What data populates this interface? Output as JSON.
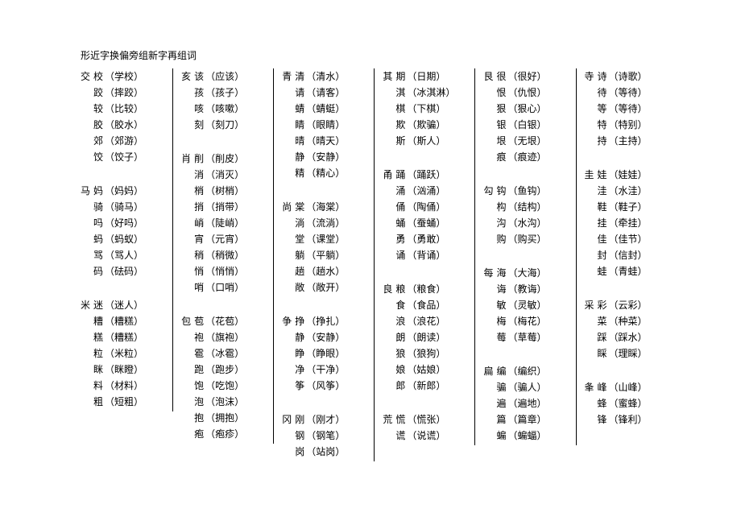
{
  "title": "形近字换偏旁组新字再组词",
  "columns": [
    {
      "groups": [
        {
          "radical": "交",
          "items": [
            {
              "char": "校",
              "word": "（学校）"
            },
            {
              "char": "跤",
              "word": "（摔跤）"
            },
            {
              "char": "较",
              "word": "（比较）"
            },
            {
              "char": "胶",
              "word": "（胶水）"
            },
            {
              "char": "郊",
              "word": "（郊游）"
            },
            {
              "char": "饺",
              "word": "（饺子）"
            }
          ]
        },
        {
          "radical": "马",
          "items": [
            {
              "char": "妈",
              "word": "（妈妈）"
            },
            {
              "char": "骑",
              "word": "（骑马）"
            },
            {
              "char": "吗",
              "word": "（好吗）"
            },
            {
              "char": "蚂",
              "word": "（蚂蚁）"
            },
            {
              "char": "骂",
              "word": "（骂人）"
            },
            {
              "char": "码",
              "word": "（砝码）"
            }
          ]
        },
        {
          "radical": "米",
          "items": [
            {
              "char": "迷",
              "word": "（迷人）"
            },
            {
              "char": "糟",
              "word": "（糟糕）"
            },
            {
              "char": "糕",
              "word": "（糟糕）"
            },
            {
              "char": "粒",
              "word": "（米粒）"
            },
            {
              "char": "眯",
              "word": "（眯瞪）"
            },
            {
              "char": "料",
              "word": "（材料）"
            },
            {
              "char": "粗",
              "word": "（短粗）"
            }
          ]
        }
      ]
    },
    {
      "groups": [
        {
          "radical": "亥",
          "items": [
            {
              "char": "该",
              "word": "（应该）"
            },
            {
              "char": "孩",
              "word": "（孩子）"
            },
            {
              "char": "咳",
              "word": "（咳嗽）"
            },
            {
              "char": "刻",
              "word": "（刻刀）"
            }
          ]
        },
        {
          "radical": "肖",
          "items": [
            {
              "char": "削",
              "word": "（削皮）"
            },
            {
              "char": "消",
              "word": "（消灭）"
            },
            {
              "char": "梢",
              "word": "（树梢）"
            },
            {
              "char": "捎",
              "word": "（捎带）"
            },
            {
              "char": "峭",
              "word": "（陡峭）"
            },
            {
              "char": "宵",
              "word": "（元宵）"
            },
            {
              "char": "稍",
              "word": "（稍微）"
            },
            {
              "char": "悄",
              "word": "（悄悄）"
            },
            {
              "char": "哨",
              "word": "（口哨）"
            }
          ]
        },
        {
          "radical": "包",
          "items": [
            {
              "char": "苞",
              "word": "（花苞）"
            },
            {
              "char": "袍",
              "word": "（旗袍）"
            },
            {
              "char": "雹",
              "word": "（冰雹）"
            },
            {
              "char": "跑",
              "word": "（跑步）"
            },
            {
              "char": "饱",
              "word": "（吃饱）"
            },
            {
              "char": "泡",
              "word": "（泡沫）"
            },
            {
              "char": "抱",
              "word": "（拥抱）"
            },
            {
              "char": "疱",
              "word": "（疱疹）"
            }
          ]
        }
      ]
    },
    {
      "groups": [
        {
          "radical": "青",
          "items": [
            {
              "char": "清",
              "word": "（清水）"
            },
            {
              "char": "请",
              "word": "（请客）"
            },
            {
              "char": "蜻",
              "word": "（蜻蜓）"
            },
            {
              "char": "睛",
              "word": "（眼睛）"
            },
            {
              "char": "晴",
              "word": "（晴天）"
            },
            {
              "char": "静",
              "word": "（安静）"
            },
            {
              "char": "精",
              "word": "（精心）"
            }
          ]
        },
        {
          "radical": "尚",
          "items": [
            {
              "char": "棠",
              "word": "（海棠）"
            },
            {
              "char": "淌",
              "word": "（流淌）"
            },
            {
              "char": "堂",
              "word": "（课堂）"
            },
            {
              "char": "躺",
              "word": "（平躺）"
            },
            {
              "char": "趟",
              "word": "（趟水）"
            },
            {
              "char": "敞",
              "word": "（敞开）"
            }
          ]
        },
        {
          "radical": "争",
          "items": [
            {
              "char": "挣",
              "word": "（挣扎）"
            },
            {
              "char": "静",
              "word": "（安静）"
            },
            {
              "char": "睁",
              "word": "（睁眼）"
            },
            {
              "char": "净",
              "word": "（干净）"
            },
            {
              "char": "筝",
              "word": "（风筝）"
            }
          ]
        },
        {
          "radical": "冈",
          "items": [
            {
              "char": "刚",
              "word": "（刚才）"
            },
            {
              "char": "钢",
              "word": "（钢笔）"
            },
            {
              "char": "岗",
              "word": "（站岗）"
            }
          ]
        }
      ]
    },
    {
      "groups": [
        {
          "radical": "其",
          "items": [
            {
              "char": "期",
              "word": "（日期）"
            },
            {
              "char": "淇",
              "word": "（冰淇淋）"
            },
            {
              "char": "棋",
              "word": "（下棋）"
            },
            {
              "char": "欺",
              "word": "（欺骗）"
            },
            {
              "char": "斯",
              "word": "（斯人）"
            }
          ]
        },
        {
          "radical": "甬",
          "items": [
            {
              "char": "踊",
              "word": "（踊跃）"
            },
            {
              "char": "涌",
              "word": "（汹涌）"
            },
            {
              "char": "俑",
              "word": "（陶俑）"
            },
            {
              "char": "蛹",
              "word": "（蚕蛹）"
            },
            {
              "char": "勇",
              "word": "（勇敢）"
            },
            {
              "char": "诵",
              "word": "（背诵）"
            }
          ]
        },
        {
          "radical": "良",
          "items": [
            {
              "char": "粮",
              "word": "（粮食）"
            },
            {
              "char": "食",
              "word": "（食品）"
            },
            {
              "char": "浪",
              "word": "（浪花）"
            },
            {
              "char": "朗",
              "word": "（朗读）"
            },
            {
              "char": "狼",
              "word": "（狼狗）"
            },
            {
              "char": "娘",
              "word": "（姑娘）"
            },
            {
              "char": "郎",
              "word": "（新郎）"
            }
          ]
        },
        {
          "radical": "荒",
          "items": [
            {
              "char": "慌",
              "word": "（慌张）"
            },
            {
              "char": "谎",
              "word": "（说谎）"
            }
          ]
        }
      ]
    },
    {
      "groups": [
        {
          "radical": "艮",
          "items": [
            {
              "char": "很",
              "word": "（很好）"
            },
            {
              "char": "恨",
              "word": "（仇恨）"
            },
            {
              "char": "狠",
              "word": "（狠心）"
            },
            {
              "char": "银",
              "word": "（白银）"
            },
            {
              "char": "垠",
              "word": "（无垠）"
            },
            {
              "char": "痕",
              "word": "（痕迹）"
            }
          ]
        },
        {
          "radical": "勾",
          "items": [
            {
              "char": "钩",
              "word": "（鱼钩）"
            },
            {
              "char": "构",
              "word": "（结构）"
            },
            {
              "char": "沟",
              "word": "（水沟）"
            },
            {
              "char": "购",
              "word": "（购买）"
            }
          ]
        },
        {
          "radical": "每",
          "items": [
            {
              "char": "海",
              "word": "（大海）"
            },
            {
              "char": "诲",
              "word": "（教诲）"
            },
            {
              "char": "敏",
              "word": "（灵敏）"
            },
            {
              "char": "梅",
              "word": "（梅花）"
            },
            {
              "char": "莓",
              "word": "（草莓）"
            }
          ]
        },
        {
          "radical": "扁",
          "items": [
            {
              "char": "编",
              "word": "（编织）"
            },
            {
              "char": "骗",
              "word": "（骗人）"
            },
            {
              "char": "遍",
              "word": "（遍地）"
            },
            {
              "char": "篇",
              "word": "（篇章）"
            },
            {
              "char": "蝙",
              "word": "（蝙蝠）"
            }
          ]
        }
      ]
    },
    {
      "groups": [
        {
          "radical": "寺",
          "items": [
            {
              "char": "诗",
              "word": "（诗歌）"
            },
            {
              "char": "待",
              "word": "（等待）"
            },
            {
              "char": "等",
              "word": "（等待）"
            },
            {
              "char": "特",
              "word": "（特别）"
            },
            {
              "char": "持",
              "word": "（主持）"
            }
          ]
        },
        {
          "radical": "圭",
          "items": [
            {
              "char": "娃",
              "word": "（娃娃）"
            },
            {
              "char": "洼",
              "word": "（水洼）"
            },
            {
              "char": "鞋",
              "word": "（鞋子）"
            },
            {
              "char": "挂",
              "word": "（牵挂）"
            },
            {
              "char": "佳",
              "word": "（佳节）"
            },
            {
              "char": "封",
              "word": "（信封）"
            },
            {
              "char": "蛙",
              "word": "（青蛙）"
            }
          ]
        },
        {
          "radical": "采",
          "items": [
            {
              "char": "彩",
              "word": "（云彩）"
            },
            {
              "char": "菜",
              "word": "（种菜）"
            },
            {
              "char": "踩",
              "word": "（踩水）"
            },
            {
              "char": "睬",
              "word": "（理睬）"
            }
          ]
        },
        {
          "radical": "夆",
          "items": [
            {
              "char": "峰",
              "word": "（山峰）"
            },
            {
              "char": "蜂",
              "word": "（蜜蜂）"
            },
            {
              "char": "锋",
              "word": "（锋利）"
            }
          ]
        }
      ]
    }
  ]
}
